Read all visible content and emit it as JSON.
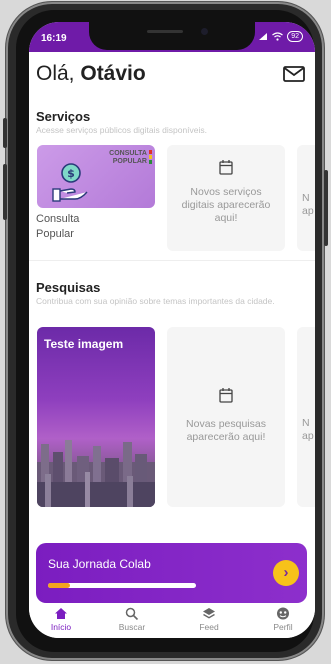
{
  "status": {
    "time": "16:19",
    "battery": "92"
  },
  "header": {
    "greeting_prefix": "Olá, ",
    "user_name": "Otávio"
  },
  "services": {
    "title": "Serviços",
    "subtitle": "Acesse serviços públicos digitais disponíveis.",
    "card": {
      "logo_line1": "CONSULTA",
      "logo_line2": "POPULAR",
      "label_line1": "Consulta",
      "label_line2": "Popular"
    },
    "placeholder_text": "Novos serviços digitais aparecerão aqui!",
    "partial_next": "N ap"
  },
  "surveys": {
    "title": "Pesquisas",
    "subtitle": "Contribua com sua opinião sobre temas importantes da cidade.",
    "card": {
      "title": "Teste imagem"
    },
    "placeholder_text": "Novas pesquisas aparecerão aqui!",
    "partial_next": "N ap"
  },
  "journey": {
    "title": "Sua Jornada Colab",
    "progress": 0.15,
    "arrow": "›"
  },
  "nav": [
    {
      "label": "Início",
      "icon": "home-icon",
      "active": true
    },
    {
      "label": "Buscar",
      "icon": "search-icon",
      "active": false
    },
    {
      "label": "Feed",
      "icon": "layers-icon",
      "active": false
    },
    {
      "label": "Perfil",
      "icon": "profile-icon",
      "active": false
    }
  ],
  "colors": {
    "accent": "#7b1dc0",
    "progress": "#f3a51f",
    "arrow_bg": "#f7c21a"
  }
}
